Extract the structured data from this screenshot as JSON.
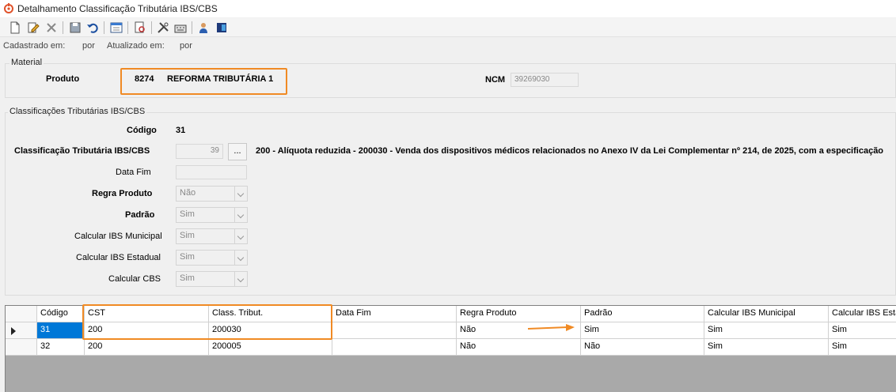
{
  "window": {
    "title": "Detalhamento Classificação Tributária IBS/CBS"
  },
  "toolbar": {
    "buttons": [
      "new-icon",
      "edit-icon",
      "delete-icon",
      "save-icon",
      "undo-icon",
      "form-icon",
      "search-document-icon",
      "tools-icon",
      "keyboard-icon",
      "user-icon",
      "book-icon"
    ]
  },
  "audit": {
    "created_label": "Cadastrado em:",
    "created_by": "por",
    "updated_label": "Atualizado em:",
    "updated_by": "por"
  },
  "material": {
    "group_title": "Material",
    "produto_label": "Produto",
    "produto_code": "8274",
    "produto_name": "REFORMA TRIBUTÁRIA 1",
    "ncm_label": "NCM",
    "ncm_value": "39269030"
  },
  "classificacoes": {
    "group_title": "Classificações Tributárias IBS/CBS",
    "codigo_label": "Código",
    "codigo_value": "31",
    "class_label": "Classificação Tributária IBS/CBS",
    "class_value": "39",
    "lookup_button": "...",
    "class_description": "200 - Alíquota reduzida - 200030 - Venda dos dispositivos médicos relacionados no Anexo IV da Lei Complementar nº 214, de 2025, com a especificação",
    "data_fim_label": "Data Fim",
    "data_fim_value": "",
    "regra_produto_label": "Regra Produto",
    "regra_produto_value": "Não",
    "padrao_label": "Padrão",
    "padrao_value": "Sim",
    "ibs_municipal_label": "Calcular IBS Municipal",
    "ibs_municipal_value": "Sim",
    "ibs_estadual_label": "Calcular IBS Estadual",
    "ibs_estadual_value": "Sim",
    "cbs_label": "Calcular CBS",
    "cbs_value": "Sim"
  },
  "grid": {
    "columns": [
      "Código",
      "CST",
      "Class. Tribut.",
      "Data Fim",
      "Regra Produto",
      "Padrão",
      "Calcular IBS Municipal",
      "Calcular IBS Estadual"
    ],
    "rows": [
      [
        "31",
        "200",
        "200030",
        "",
        "Não",
        "Sim",
        "Sim",
        "Sim"
      ],
      [
        "32",
        "200",
        "200005",
        "",
        "Não",
        "Não",
        "Sim",
        "Sim"
      ]
    ]
  },
  "colors": {
    "highlight": "#f08a24",
    "selection": "#0078d7"
  }
}
